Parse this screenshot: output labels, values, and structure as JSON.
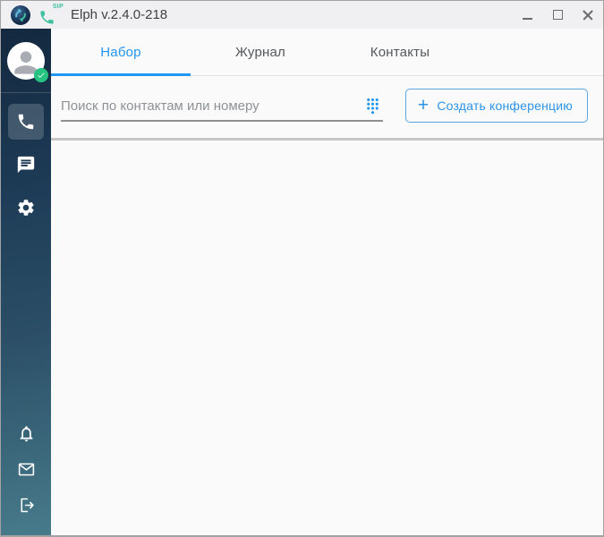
{
  "window": {
    "title": "Elph v.2.4.0-218",
    "sip_label": "SIP",
    "controls": [
      {
        "name": "minimize"
      },
      {
        "name": "maximize"
      },
      {
        "name": "close"
      }
    ]
  },
  "sidebar": {
    "avatar": {
      "status": "online"
    },
    "nav_items": [
      {
        "name": "dialer",
        "icon": "phone-icon",
        "active": true
      },
      {
        "name": "chat",
        "icon": "chat-icon",
        "active": false
      },
      {
        "name": "settings",
        "icon": "gear-icon",
        "active": false
      }
    ],
    "bottom_items": [
      {
        "name": "notifications",
        "icon": "bell-icon"
      },
      {
        "name": "mail",
        "icon": "envelope-icon"
      },
      {
        "name": "logout",
        "icon": "logout-icon"
      }
    ]
  },
  "tabs": [
    {
      "label": "Набор",
      "active": true
    },
    {
      "label": "Журнал",
      "active": false
    },
    {
      "label": "Контакты",
      "active": false
    }
  ],
  "search": {
    "placeholder": "Поиск по контактам или номеру",
    "value": "",
    "icon": "dialpad-icon"
  },
  "actions": {
    "create_conference": {
      "plus": "+",
      "label": "Создать конференцию"
    }
  },
  "colors": {
    "accent_blue": "#2196f3",
    "button_blue": "#2d93e6",
    "sidebar_gradient_top": "#13293f",
    "sidebar_gradient_bottom": "#477b8b",
    "status_online_green": "#26c281",
    "sip_green": "#3cc19e",
    "titlebar_bg": "#f0eff1",
    "content_bg": "#fafafa"
  }
}
